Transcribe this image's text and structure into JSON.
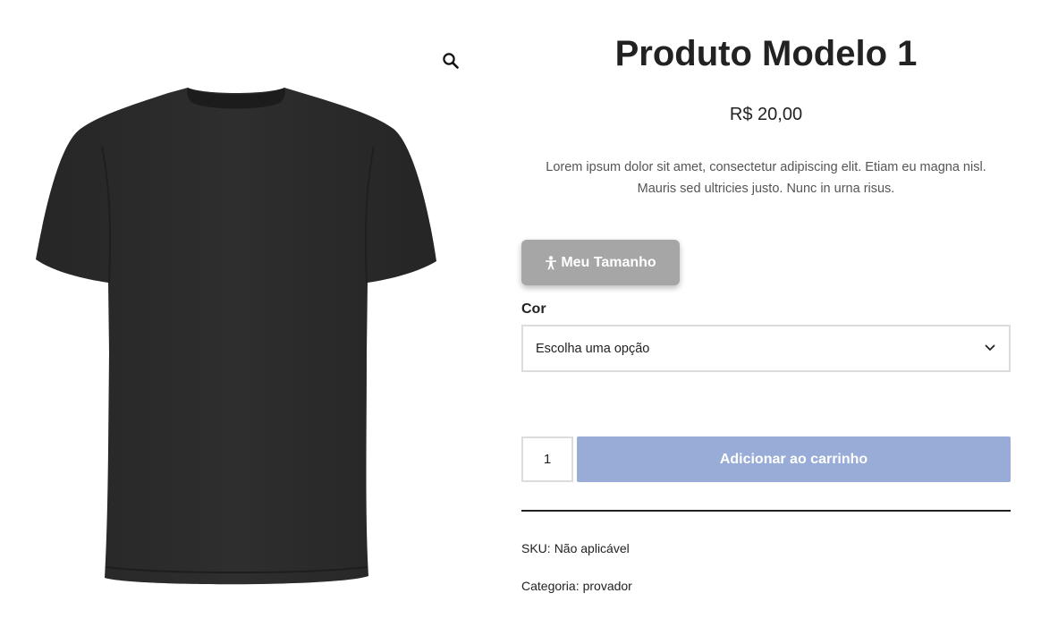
{
  "product": {
    "title": "Produto Modelo 1",
    "price": "R$ 20,00",
    "description": "Lorem ipsum dolor sit amet, consectetur adipiscing elit. Etiam eu magna nisl. Mauris sed ultricies justo. Nunc in urna risus.",
    "image_icon": "black-tshirt",
    "zoom_icon": "magnifier-icon"
  },
  "size_button": {
    "label": "Meu Tamanho",
    "icon": "person-icon",
    "color": "#a6a6a6"
  },
  "attribute": {
    "label": "Cor",
    "select_value": "Escolha uma opção"
  },
  "cart": {
    "quantity": "1",
    "add_label": "Adicionar ao carrinho",
    "button_color": "#98acd7"
  },
  "meta": {
    "sku_label": "SKU:",
    "sku_value": "Não aplicável",
    "category_label": "Categoria:",
    "category_value": "provador"
  }
}
